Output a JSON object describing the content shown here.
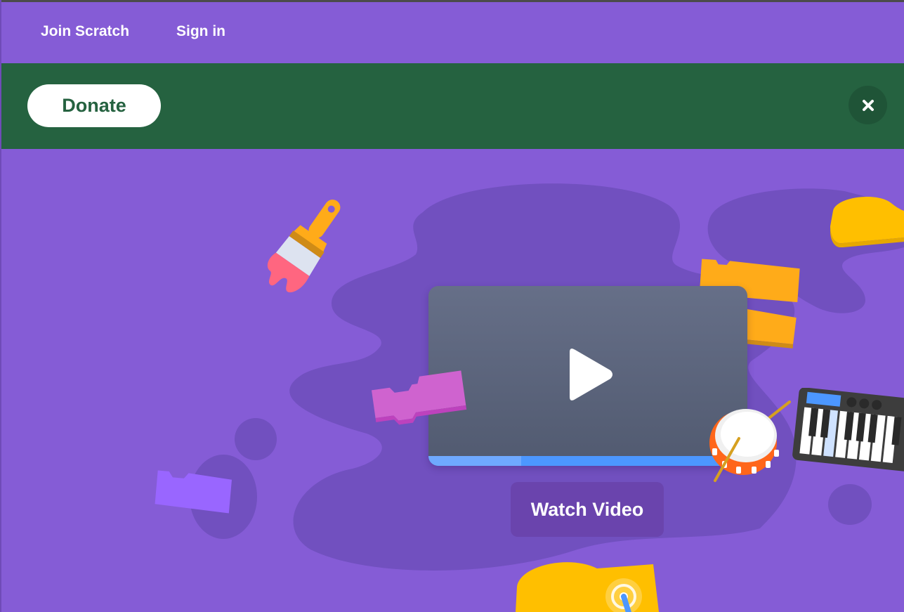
{
  "nav": {
    "join_label": "Join Scratch",
    "signin_label": "Sign in"
  },
  "banner": {
    "donate_label": "Donate",
    "close_icon": "close-icon"
  },
  "hero": {
    "watch_label": "Watch Video",
    "video_progress": 0.29,
    "icons": [
      "paintbrush-icon",
      "play-icon",
      "drum-icon",
      "keyboard-icon",
      "puzzle-block-icon"
    ]
  },
  "colors": {
    "nav_bg": "#855cd6",
    "banner_bg": "#256240",
    "blob": "#7150bf",
    "video_bar": "#4c97ff",
    "accent_orange": "#ffab19",
    "accent_yellow": "#ffbf00",
    "accent_pink": "#cf63cf"
  }
}
